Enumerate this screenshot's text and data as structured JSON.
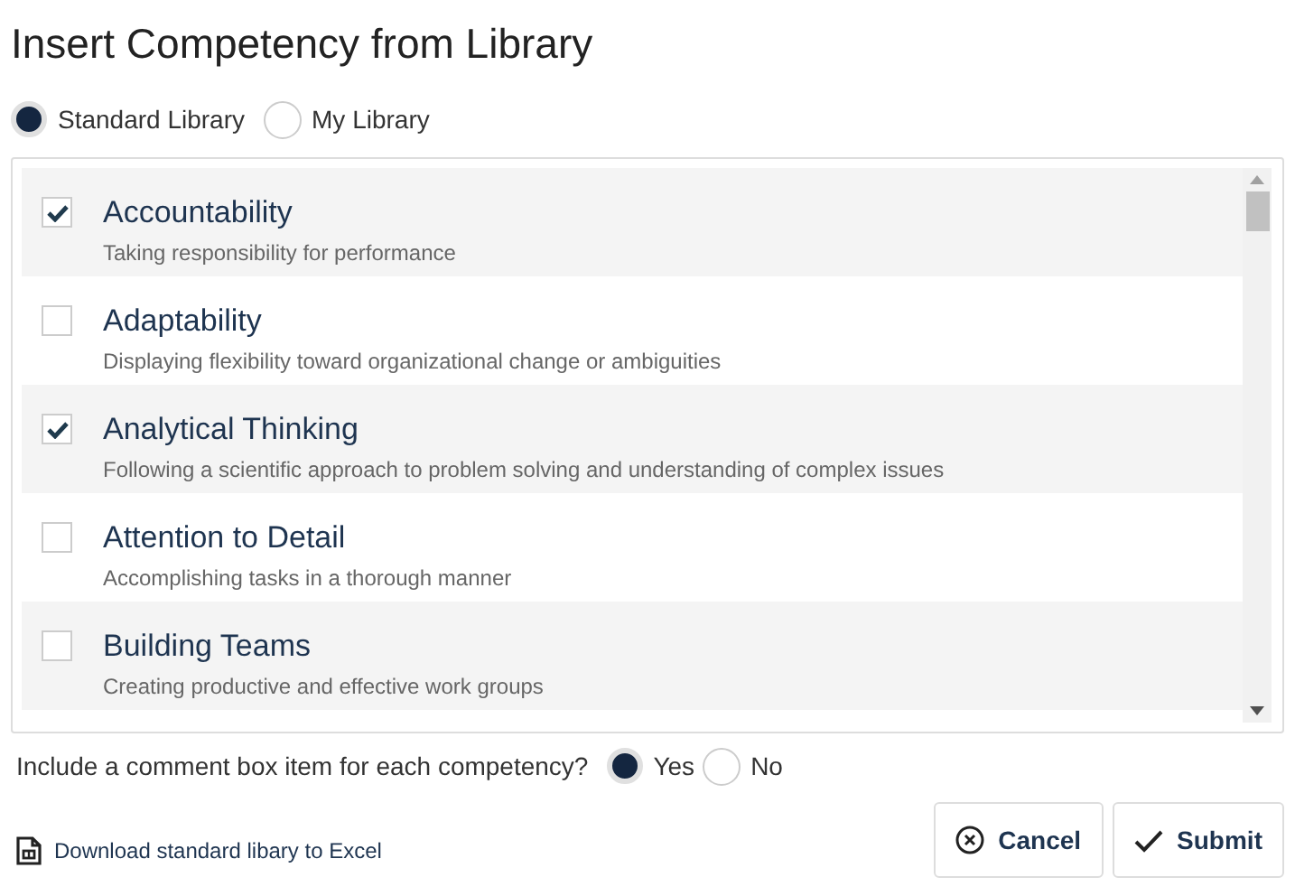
{
  "title": "Insert Competency from Library",
  "library_options": [
    {
      "label": "Standard Library",
      "selected": true
    },
    {
      "label": "My Library",
      "selected": false
    }
  ],
  "competencies": [
    {
      "name": "Accountability",
      "description": "Taking responsibility for performance",
      "checked": true
    },
    {
      "name": "Adaptability",
      "description": "Displaying flexibility toward organizational change or ambiguities",
      "checked": false
    },
    {
      "name": "Analytical Thinking",
      "description": "Following a scientific approach to problem solving and understanding of complex issues",
      "checked": true
    },
    {
      "name": "Attention to Detail",
      "description": "Accomplishing tasks in a thorough manner",
      "checked": false
    },
    {
      "name": "Building Teams",
      "description": "Creating productive and effective work groups",
      "checked": false
    }
  ],
  "comment_question": {
    "label": "Include a comment box item for each competency?",
    "options": [
      {
        "label": "Yes",
        "selected": true
      },
      {
        "label": "No",
        "selected": false
      }
    ]
  },
  "download_link": "Download standard libary to Excel",
  "buttons": [
    {
      "label": "Cancel",
      "kind": "cancel"
    },
    {
      "label": "Submit",
      "kind": "submit"
    }
  ]
}
